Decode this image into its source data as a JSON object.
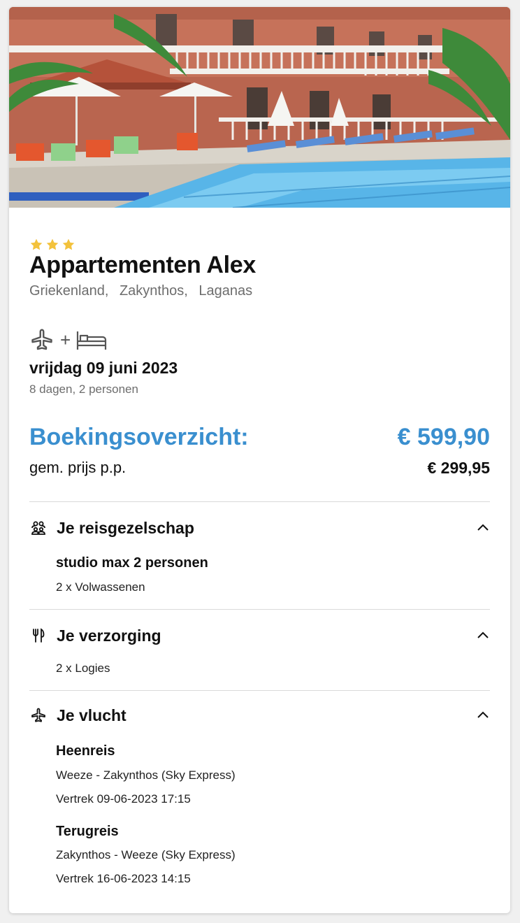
{
  "hotel": {
    "stars": 3,
    "name": "Appartementen Alex",
    "location": [
      "Griekenland,",
      "Zakynthos,",
      "Laganas"
    ]
  },
  "trip": {
    "transport_icons": [
      "plane-icon",
      "plus-icon",
      "bed-icon"
    ],
    "plus": "+",
    "date": "vrijdag 09 juni 2023",
    "duration": "8 dagen, 2 personen"
  },
  "summary": {
    "label": "Boekingsoverzicht:",
    "total": "€ 599,90",
    "pp_label": "gem. prijs p.p.",
    "pp_value": "€ 299,95"
  },
  "sections": {
    "travel_party": {
      "icon": "group-icon",
      "title": "Je reisgezelschap",
      "room": "studio max 2 personen",
      "guests": "2 x Volwassenen"
    },
    "board": {
      "icon": "cutlery-icon",
      "title": "Je verzorging",
      "detail": "2 x Logies"
    },
    "flight": {
      "icon": "plane-icon",
      "title": "Je vlucht",
      "outbound_title": "Heenreis",
      "outbound_route": "Weeze - Zakynthos (Sky Express)",
      "outbound_departure": "Vertrek 09-06-2023 17:15",
      "return_title": "Terugreis",
      "return_route": "Zakynthos - Weeze (Sky Express)",
      "return_departure": "Vertrek 16-06-2023 14:15"
    }
  },
  "colors": {
    "accent": "#3a8fcf",
    "star": "#f3c23c",
    "muted": "#6d6d6d",
    "divider": "#dadada"
  }
}
